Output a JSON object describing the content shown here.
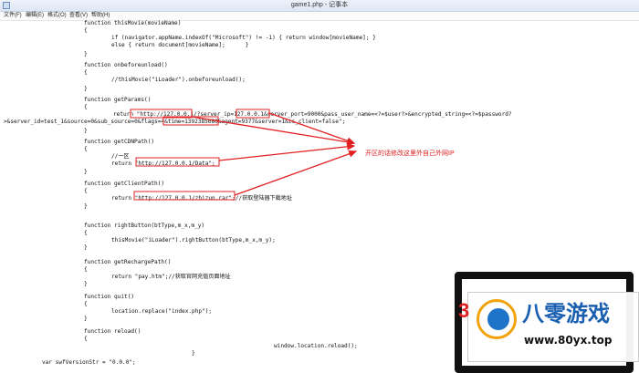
{
  "window": {
    "title": "game1.php - 记事本",
    "icon": "notepad-icon"
  },
  "menu": [
    "文件(F)",
    "编辑(E)",
    "格式(O)",
    "查看(V)",
    "帮助(H)"
  ],
  "code": [
    "function thisMovie(movieName)",
    "{",
    "if (navigator.appName.indexOf(\"Microsoft\") != -1) { return window[movieName]; }",
    "else { return document[movieName];      }",
    "}",
    "function onbeforeunload()",
    "{",
    "//thisMovie(\"iLoader\").onbeforeunload();",
    "}",
    "function getParams()",
    "{",
    "return \"http://127.0.0.1/?server_ip=127.0.0.1&server_port=9000&pass_user_name=<?=$user?>&encrypted_string=<?=$password?",
    ">&server_id=test_1&source=0&sub_source=0&flags=4&time=1392385680&agent=9377&server=1&is_client=false\";",
    "}",
    "function getCDNPath()",
    "{",
    "//一区",
    "return \"http://127.0.0.1/Data\";",
    "}",
    "function getClientPath()",
    "{",
    "return \"http://127.0.0.1/zhizun.rar\";//获取登陆器下载地址",
    "}",
    "function rightButton(btType,m_x,m_y)",
    "{",
    "thisMovie(\"iLoader\").rightButton(btType,m_x,m_y);",
    "}",
    "function getRechargePath()",
    "{",
    "return \"pay.htm\";//获取官网充值页面地址",
    "}",
    "function quit()",
    "{",
    "location.replace(\"index.php\");",
    "}",
    "function reload()",
    "{",
    "window.location.reload();",
    "}",
    "var swfVersionStr = \"0.0.0\";"
  ],
  "annotation": {
    "text": "开区的话修改这里外自己外网IP",
    "color": "#e02020"
  },
  "watermark": {
    "brand": "八零游戏",
    "site": "www.80yx.top",
    "digit": "3"
  }
}
